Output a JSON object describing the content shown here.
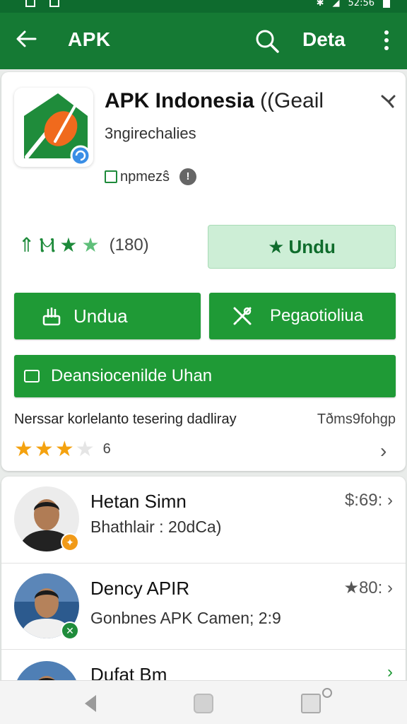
{
  "status_bar": {
    "right_text": "52:56"
  },
  "app_bar": {
    "title": "APK",
    "detail_label": "Deta"
  },
  "app": {
    "name": "APK Indonesia",
    "name_extra": " ((Geail",
    "developer": "3ngirechalies",
    "package": "npmezŝ",
    "rating_count": "(180)",
    "install_label": "Undu",
    "accent_color": "#1f9a36"
  },
  "actions": {
    "download_label": "Undua",
    "manage_label": "Pegaotioliua",
    "description_label": "Deansiocenilde Uhan"
  },
  "rating_detail": {
    "message": "Nerssar korlelanto tesering dadliray",
    "right_text": "Tðms9fohgp",
    "count": "6",
    "stars_filled": 3,
    "stars_total": 4
  },
  "reviews": [
    {
      "name": "Hetan Simn",
      "subtitle": "Bhathlair : 20dCa)",
      "price": "$:69:"
    },
    {
      "name": "Dency APIR",
      "subtitle": "Gonbnes APK Camen; 2:9",
      "price": "★80:"
    },
    {
      "name": "Dufat Bm"
    }
  ]
}
